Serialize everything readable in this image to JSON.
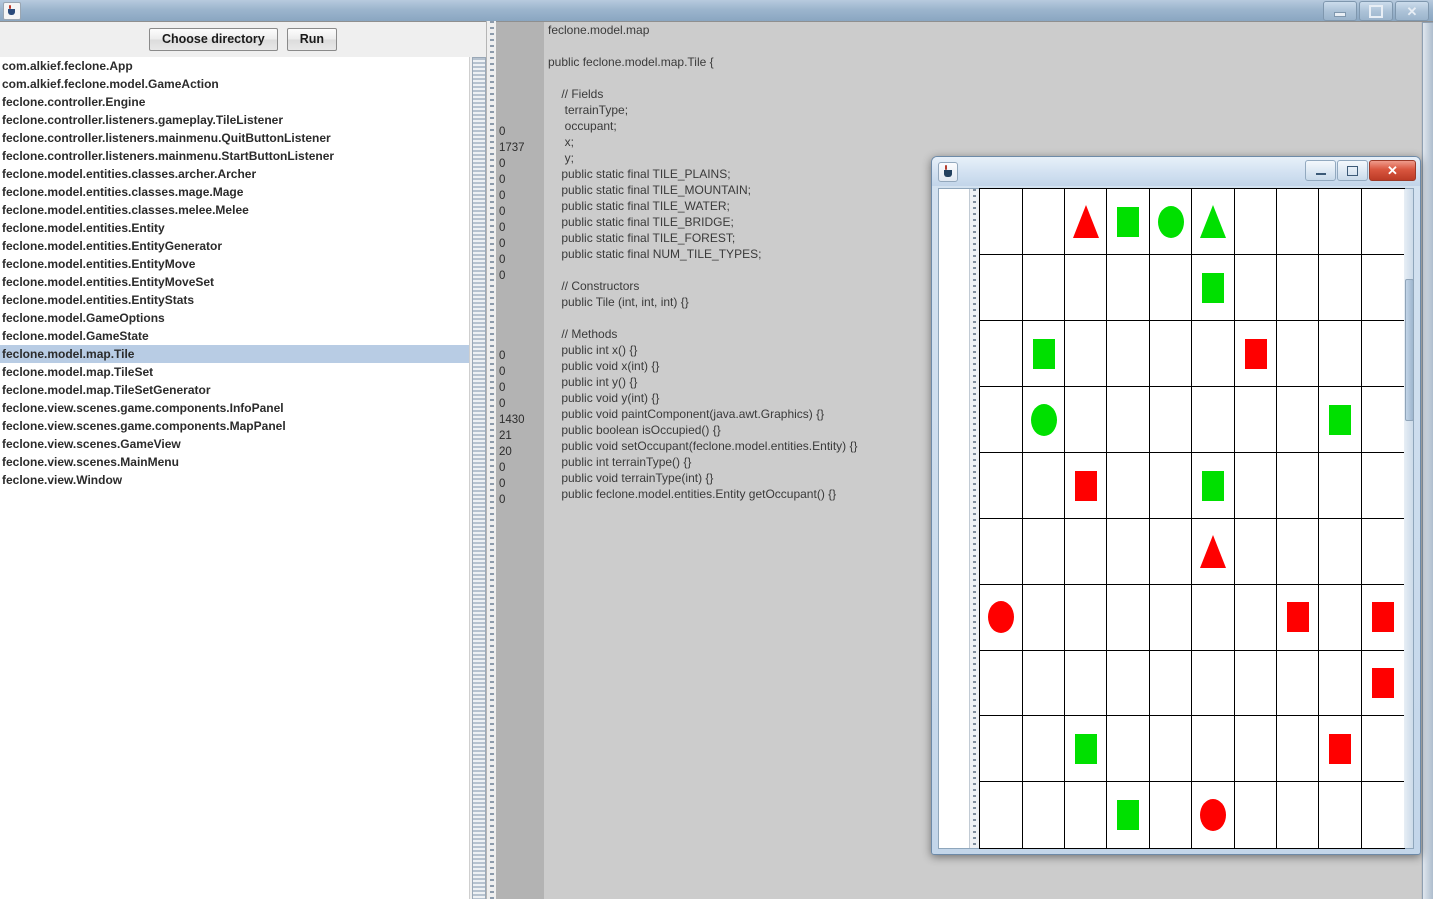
{
  "os": {
    "taskbar_present": true
  },
  "app_window": {
    "title": "",
    "icon": "java-cup-icon",
    "controls": {
      "minimize": "minimize-icon",
      "maximize": "maximize-icon",
      "close": "close-icon"
    }
  },
  "toolbar": {
    "choose_directory_label": "Choose directory",
    "run_label": "Run"
  },
  "class_list": {
    "selected_index": 16,
    "items": [
      "com.alkief.feclone.App",
      "com.alkief.feclone.model.GameAction",
      "feclone.controller.Engine",
      "feclone.controller.listeners.gameplay.TileListener",
      "feclone.controller.listeners.mainmenu.QuitButtonListener",
      "feclone.controller.listeners.mainmenu.StartButtonListener",
      "feclone.model.entities.classes.archer.Archer",
      "feclone.model.entities.classes.mage.Mage",
      "feclone.model.entities.classes.melee.Melee",
      "feclone.model.entities.Entity",
      "feclone.model.entities.EntityGenerator",
      "feclone.model.entities.EntityMove",
      "feclone.model.entities.EntityMoveSet",
      "feclone.model.entities.EntityStats",
      "feclone.model.GameOptions",
      "feclone.model.GameState",
      "feclone.model.map.Tile",
      "feclone.model.map.TileSet",
      "feclone.model.map.TileSetGenerator",
      "feclone.view.scenes.game.components.InfoPanel",
      "feclone.view.scenes.game.components.MapPanel",
      "feclone.view.scenes.GameView",
      "feclone.view.scenes.MainMenu",
      "feclone.view.Window"
    ]
  },
  "counts": {
    "group_a": [
      "0",
      "1737",
      "0",
      "0",
      "0",
      "0",
      "0",
      "0",
      "0",
      "0"
    ],
    "group_b": [
      "0",
      "0",
      "0",
      "0",
      "1430",
      "21",
      "20",
      "0",
      "0",
      "0"
    ]
  },
  "code_panel": {
    "package_line": "feclone.model.map",
    "lines": [
      "feclone.model.map",
      "",
      "public feclone.model.map.Tile {",
      "",
      "    // Fields",
      "     terrainType;",
      "     occupant;",
      "     x;",
      "     y;",
      "    public static final TILE_PLAINS;",
      "    public static final TILE_MOUNTAIN;",
      "    public static final TILE_WATER;",
      "    public static final TILE_BRIDGE;",
      "    public static final TILE_FOREST;",
      "    public static final NUM_TILE_TYPES;",
      "",
      "    // Constructors",
      "    public Tile (int, int, int) {}",
      "",
      "    // Methods",
      "    public int x() {}",
      "    public void x(int) {}",
      "    public int y() {}",
      "    public void y(int) {}",
      "    public void paintComponent(java.awt.Graphics) {}",
      "    public boolean isOccupied() {}",
      "    public void setOccupant(feclone.model.entities.Entity) {}",
      "    public int terrainType() {}",
      "    public void terrainType(int) {}",
      "    public feclone.model.entities.Entity getOccupant() {}"
    ]
  },
  "game_window": {
    "title": "",
    "icon": "java-cup-icon",
    "controls": {
      "minimize": "minimize-icon",
      "maximize": "maximize-icon",
      "close": "close-icon"
    },
    "colors": {
      "green": "#00e000",
      "red": "#ff0000",
      "grid_line": "#000000",
      "cell_background": "#ffffff"
    },
    "map": {
      "rows": 10,
      "cols": 10,
      "cells": [
        [
          null,
          null,
          {
            "shape": "triangle",
            "color": "#ff0000"
          },
          {
            "shape": "rect",
            "color": "#00e000"
          },
          {
            "shape": "circle",
            "color": "#00e000"
          },
          {
            "shape": "triangle",
            "color": "#00e000"
          },
          null,
          null,
          null,
          null
        ],
        [
          null,
          null,
          null,
          null,
          null,
          {
            "shape": "rect",
            "color": "#00e000"
          },
          null,
          null,
          null,
          null
        ],
        [
          null,
          {
            "shape": "rect",
            "color": "#00e000"
          },
          null,
          null,
          null,
          null,
          {
            "shape": "rect",
            "color": "#ff0000"
          },
          null,
          null,
          null
        ],
        [
          null,
          {
            "shape": "circle",
            "color": "#00e000"
          },
          null,
          null,
          null,
          null,
          null,
          null,
          {
            "shape": "rect",
            "color": "#00e000"
          },
          null
        ],
        [
          null,
          null,
          {
            "shape": "rect",
            "color": "#ff0000"
          },
          null,
          null,
          {
            "shape": "rect",
            "color": "#00e000"
          },
          null,
          null,
          null,
          null
        ],
        [
          null,
          null,
          null,
          null,
          null,
          {
            "shape": "triangle",
            "color": "#ff0000"
          },
          null,
          null,
          null,
          null
        ],
        [
          {
            "shape": "circle",
            "color": "#ff0000"
          },
          null,
          null,
          null,
          null,
          null,
          null,
          {
            "shape": "rect",
            "color": "#ff0000"
          },
          null,
          {
            "shape": "rect",
            "color": "#ff0000"
          }
        ],
        [
          null,
          null,
          null,
          null,
          null,
          null,
          null,
          null,
          null,
          {
            "shape": "rect",
            "color": "#ff0000"
          }
        ],
        [
          null,
          null,
          {
            "shape": "rect",
            "color": "#00e000"
          },
          null,
          null,
          null,
          null,
          null,
          {
            "shape": "rect",
            "color": "#ff0000"
          },
          null
        ],
        [
          null,
          null,
          null,
          {
            "shape": "rect",
            "color": "#00e000"
          },
          null,
          {
            "shape": "circle",
            "color": "#ff0000"
          },
          null,
          null,
          null,
          null
        ]
      ]
    }
  }
}
